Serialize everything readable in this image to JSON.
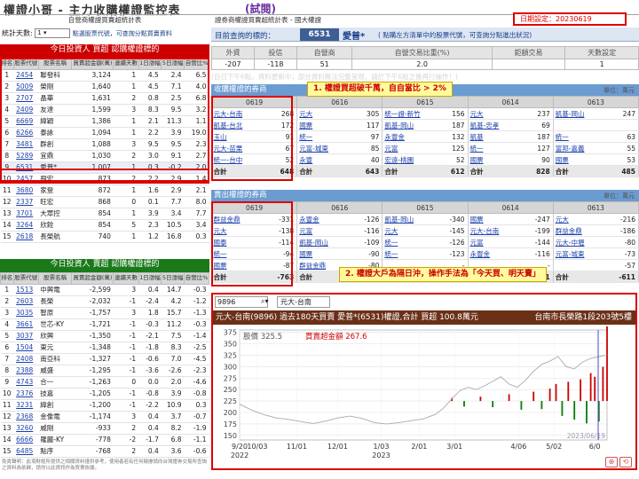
{
  "app": {
    "title": "權證小哥 - 主力收購權證監控表",
    "demo_label": "(試閱)",
    "left_header": "自營商權證買賣超統計表",
    "right_header": "證券商權證買賣超統計表 - 國大權證",
    "date_label": "日期設定：",
    "date_value": "20230619"
  },
  "controls": {
    "stat_days_label": "統計天數:",
    "stat_days_value": "1",
    "stat_hint": "點選股票代號，可查詢分點買賣資料",
    "query_label": "目前查詢的標的：",
    "query_code": "6531",
    "query_name": "愛普*",
    "query_hint": "( 點購左方清單中的股票代號，可查詢分點進出狀況)"
  },
  "inst_bar": {
    "headers": [
      "外資",
      "投信",
      "自營商",
      "自營交易比重(%)",
      "鉅額交易",
      "天數設定"
    ],
    "values": [
      "-207",
      "-118",
      "51",
      "2.0",
      "",
      "1"
    ]
  },
  "inst_note": "(自日下午6點，資料更新中；部分資料無法完整呈現，請於下午6點之後再行操作！)",
  "left_top": {
    "heading": "今日投資人 買超 認購權證標的",
    "col_headers": [
      "排名",
      "股票代號",
      "股票名稱",
      "買賣超金額(萬)",
      "連續天數",
      "1日漲幅",
      "5日漲幅",
      "自營比%"
    ],
    "rows": [
      [
        "1",
        "2454",
        "聯發科",
        "3,124",
        "1",
        "4.5",
        "2.4",
        "6.5"
      ],
      [
        "2",
        "5009",
        "榮剛",
        "1,640",
        "1",
        "4.5",
        "7.1",
        "4.0"
      ],
      [
        "3",
        "2707",
        "晶華",
        "1,631",
        "2",
        "0.8",
        "2.5",
        "6.8"
      ],
      [
        "4",
        "2409",
        "友達",
        "1,599",
        "3",
        "8.3",
        "9.5",
        "3.2"
      ],
      [
        "5",
        "6669",
        "緯穎",
        "1,386",
        "1",
        "2.1",
        "11.3",
        "1.1"
      ],
      [
        "6",
        "6266",
        "泰詠",
        "1,094",
        "1",
        "2.2",
        "3.9",
        "19.0"
      ],
      [
        "7",
        "3481",
        "群創",
        "1,088",
        "3",
        "9.5",
        "9.5",
        "2.3"
      ],
      [
        "8",
        "5289",
        "宜鼎",
        "1,030",
        "2",
        "3.0",
        "9.1",
        "2.7"
      ],
      [
        "9",
        "6531",
        "愛普*",
        "1,007",
        "1",
        "0.3",
        "-0.2",
        "2.0"
      ],
      [
        "10",
        "2457",
        "飛宏",
        "873",
        "2",
        "2.2",
        "2.9",
        "1.4"
      ],
      [
        "11",
        "3680",
        "家登",
        "872",
        "1",
        "1.6",
        "2.9",
        "2.1"
      ],
      [
        "12",
        "2337",
        "旺宏",
        "868",
        "0",
        "0.1",
        "7.7",
        "8.0"
      ],
      [
        "13",
        "3701",
        "大眾控",
        "854",
        "1",
        "3.9",
        "3.4",
        "7.7"
      ],
      [
        "14",
        "3264",
        "欣銓",
        "854",
        "5",
        "2.3",
        "10.5",
        "3.4"
      ],
      [
        "15",
        "2618",
        "長榮航",
        "740",
        "1",
        "1.2",
        "16.8",
        "0.3"
      ]
    ]
  },
  "left_bottom": {
    "heading": "今日投資人 賣超 認購權證標的",
    "col_headers": [
      "排名",
      "股票代號",
      "股票名稱",
      "買賣超金額(萬)",
      "連續天數",
      "1日漲幅",
      "5日漲幅",
      "自營比%"
    ],
    "rows": [
      [
        "1",
        "1513",
        "中興電",
        "-2,599",
        "3",
        "0.4",
        "14.7",
        "-0.3"
      ],
      [
        "2",
        "2603",
        "長榮",
        "-2,032",
        "-1",
        "-2.4",
        "4.2",
        "-1.2"
      ],
      [
        "3",
        "3035",
        "智原",
        "-1,757",
        "3",
        "1.8",
        "15.7",
        "-1.3"
      ],
      [
        "4",
        "3661",
        "世芯-KY",
        "-1,721",
        "-1",
        "-0.3",
        "11.2",
        "-0.3"
      ],
      [
        "5",
        "3037",
        "欣興",
        "-1,350",
        "-1",
        "-2.1",
        "7.5",
        "-1.4"
      ],
      [
        "6",
        "1504",
        "東元",
        "-1,348",
        "-1",
        "-1.8",
        "8.3",
        "-2.5"
      ],
      [
        "7",
        "2408",
        "南亞科",
        "-1,327",
        "-1",
        "-0.6",
        "7.0",
        "-4.5"
      ],
      [
        "8",
        "2388",
        "威盛",
        "-1,295",
        "-1",
        "-3.6",
        "-2.6",
        "-2.3"
      ],
      [
        "9",
        "4743",
        "合一",
        "-1,263",
        "0",
        "0.0",
        "2.0",
        "-4.6"
      ],
      [
        "10",
        "2376",
        "技嘉",
        "-1,205",
        "-1",
        "-0.8",
        "3.9",
        "-0.8"
      ],
      [
        "11",
        "3231",
        "緯創",
        "-1,200",
        "-1",
        "-2.2",
        "10.9",
        "0.3"
      ],
      [
        "12",
        "2368",
        "金像電",
        "-1,174",
        "3",
        "0.4",
        "3.7",
        "-0.7"
      ],
      [
        "13",
        "3260",
        "威剛",
        "-933",
        "2",
        "0.4",
        "8.2",
        "-1.9"
      ],
      [
        "14",
        "6666",
        "羅麗-KY",
        "-778",
        "-2",
        "-1.7",
        "6.8",
        "-1.1"
      ],
      [
        "15",
        "6485",
        "點序",
        "-768",
        "2",
        "0.4",
        "3.6",
        "-0.6"
      ]
    ]
  },
  "disclaimer": "免責聲明：此項財經所提供之相關資料僅供參考，使用者若有任何疑慮請向台灣證券交易所查詢之資料為依歸，請勿以此資訊作為買賣依據。",
  "buy_grid": {
    "title": "收購權證的券商",
    "unit": "單位：萬元",
    "dates": [
      "0619",
      "0616",
      "0615",
      "0614",
      "0613"
    ],
    "rows": [
      [
        [
          "元大-台南",
          "268"
        ],
        [
          "元大",
          "305"
        ],
        [
          "統一證-新竹",
          "156"
        ],
        [
          "元大",
          "237"
        ],
        [
          "凱基-岡山",
          "247"
        ]
      ],
      [
        [
          "凱基-台北",
          "172"
        ],
        [
          "國票",
          "117"
        ],
        [
          "凱基-岡山",
          "187"
        ],
        [
          "凱基-忠孝",
          "69"
        ]
      ],
      [
        [
          "玉山",
          "91"
        ],
        [
          "統一",
          "97"
        ],
        [
          "永豐金",
          "132"
        ],
        [
          "凱基",
          "187"
        ],
        [
          "統一",
          "63"
        ]
      ],
      [
        [
          "元大-苗栗",
          "67"
        ],
        [
          "元富-城東",
          "85"
        ],
        [
          "元富",
          "125"
        ],
        [
          "統一",
          "127"
        ],
        [
          "富邦-嘉義",
          "55"
        ]
      ],
      [
        [
          "統一-台中",
          "52"
        ],
        [
          "永豐",
          "40"
        ],
        [
          "宏遠-桃園",
          "52"
        ],
        [
          "國票",
          "90"
        ],
        [
          "國票",
          "53"
        ]
      ]
    ],
    "totals": [
      "648",
      "643",
      "612",
      "828",
      "485"
    ],
    "total_label": "合計"
  },
  "sell_grid": {
    "title": "賣出權證的券商",
    "unit": "單位：萬元",
    "dates": [
      "0619",
      "0616",
      "0615",
      "0614",
      "0613"
    ],
    "rows": [
      [
        [
          "群益金鼎",
          "-331"
        ],
        [
          "永豐金",
          "-126"
        ],
        [
          "凱基-岡山",
          "-340"
        ],
        [
          "國票",
          "-247"
        ],
        [
          "元大",
          "-216"
        ]
      ],
      [
        [
          "元大",
          "-138"
        ],
        [
          "元富",
          "-116"
        ],
        [
          "元大",
          "-145"
        ],
        [
          "元大-台南",
          "-199"
        ],
        [
          "群益金鼎",
          "-186"
        ]
      ],
      [
        [
          "國泰",
          "-114"
        ],
        [
          "凱基-岡山",
          "-109"
        ],
        [
          "統一",
          "-126"
        ],
        [
          "元富",
          "-144"
        ],
        [
          "元大-中壢",
          "-80"
        ]
      ],
      [
        [
          "統一",
          "-94"
        ],
        [
          "國票",
          "-90"
        ],
        [
          "統一",
          "-123"
        ],
        [
          "永豐金",
          "-116"
        ],
        [
          "元富-城東",
          "-73"
        ]
      ],
      [
        [
          "國票",
          "-87"
        ],
        [
          "群益金鼎",
          "-80"
        ],
        [
          "",
          "-"
        ],
        [
          "",
          "-"
        ],
        [
          "",
          "-57"
        ]
      ]
    ],
    "totals": [
      "-763",
      "-516",
      "-813",
      "-801",
      "-611"
    ],
    "total_label": "合計"
  },
  "callouts": {
    "c1": "1. 權證買超破千萬，自自當比 > 2%",
    "c2": "2. 權證大戶為隔日沖，操作手法為「今天買、明天賣」"
  },
  "broker_search": {
    "value": "9896",
    "broker_name": "元大-台南"
  },
  "chart_header": {
    "left": "元大-台南(9896) 過去180天買賣 愛普*(6531)權證,合計 買超 100.8萬元",
    "right": "台南市長榮路1段203號5樓"
  },
  "chart_data": {
    "type": "line",
    "price_label": "股價 325.5",
    "amount_label": "買賣超金額 267.6",
    "x_ticks": [
      "9/20",
      "10/03",
      "11/01",
      "12/01",
      "1/03",
      "2/01",
      "3/01",
      "4/06",
      "5/02",
      "6/0"
    ],
    "year_labels": [
      "2022",
      "2023"
    ],
    "end_date_label": "2023/06/19",
    "y_ticks": [
      375,
      350,
      325,
      300,
      275,
      250,
      225,
      200,
      175,
      150
    ],
    "ylim": [
      140,
      380
    ],
    "price_series": [
      {
        "d": 0,
        "v": 218
      },
      {
        "d": 6,
        "v": 205
      },
      {
        "d": 12,
        "v": 195
      },
      {
        "d": 18,
        "v": 188
      },
      {
        "d": 24,
        "v": 185
      },
      {
        "d": 30,
        "v": 180
      },
      {
        "d": 36,
        "v": 176
      },
      {
        "d": 42,
        "v": 181
      },
      {
        "d": 48,
        "v": 188
      },
      {
        "d": 54,
        "v": 192
      },
      {
        "d": 60,
        "v": 187
      },
      {
        "d": 66,
        "v": 178
      },
      {
        "d": 72,
        "v": 175
      },
      {
        "d": 78,
        "v": 178
      },
      {
        "d": 84,
        "v": 182
      },
      {
        "d": 90,
        "v": 186
      },
      {
        "d": 96,
        "v": 196
      },
      {
        "d": 100,
        "v": 210
      },
      {
        "d": 104,
        "v": 230
      },
      {
        "d": 108,
        "v": 248
      },
      {
        "d": 112,
        "v": 255
      },
      {
        "d": 116,
        "v": 250
      },
      {
        "d": 120,
        "v": 258
      },
      {
        "d": 124,
        "v": 268
      },
      {
        "d": 128,
        "v": 278
      },
      {
        "d": 132,
        "v": 262
      },
      {
        "d": 136,
        "v": 255
      },
      {
        "d": 140,
        "v": 270
      },
      {
        "d": 144,
        "v": 290
      },
      {
        "d": 148,
        "v": 305
      },
      {
        "d": 152,
        "v": 312
      },
      {
        "d": 156,
        "v": 322
      },
      {
        "d": 160,
        "v": 300
      },
      {
        "d": 164,
        "v": 295
      },
      {
        "d": 168,
        "v": 310
      },
      {
        "d": 172,
        "v": 318
      },
      {
        "d": 176,
        "v": 322
      },
      {
        "d": 180,
        "v": 325.5
      }
    ],
    "amount_bars": [
      {
        "d": 104,
        "v": 10
      },
      {
        "d": 110,
        "v": -18
      },
      {
        "d": 118,
        "v": 14
      },
      {
        "d": 124,
        "v": -20
      },
      {
        "d": 132,
        "v": 22
      },
      {
        "d": 138,
        "v": -28
      },
      {
        "d": 144,
        "v": 30
      },
      {
        "d": 148,
        "v": -26
      },
      {
        "d": 152,
        "v": 40
      },
      {
        "d": 155,
        "v": 55
      },
      {
        "d": 158,
        "v": -48
      },
      {
        "d": 161,
        "v": 62
      },
      {
        "d": 164,
        "v": -60
      },
      {
        "d": 167,
        "v": 70
      },
      {
        "d": 170,
        "v": -72
      },
      {
        "d": 172,
        "v": 90
      },
      {
        "d": 174,
        "v": 78
      },
      {
        "d": 176,
        "v": -66
      },
      {
        "d": 178,
        "v": 110
      },
      {
        "d": 180,
        "v": 267.6
      }
    ]
  },
  "colors": {
    "accent_blue": "#6a9bd1",
    "buy_red": "#cc0000",
    "sell_green": "#0a7a0a",
    "callout_yellow": "#fffb9c"
  }
}
